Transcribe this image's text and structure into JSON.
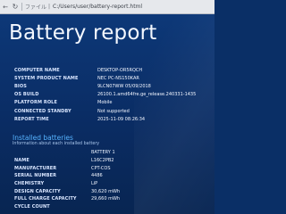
{
  "browser": {
    "url": "C:/Users/user/battery-report.html",
    "lock_label": "ファイル"
  },
  "page": {
    "title": "Battery report"
  },
  "system_info": [
    {
      "label": "COMPUTER NAME",
      "value": "DESKTOP-OR5RQCH"
    },
    {
      "label": "SYSTEM PRODUCT NAME",
      "value": "NEC PC-NS150KAR"
    },
    {
      "label": "BIOS",
      "value": "9LCN07WW 05/09/2018"
    },
    {
      "label": "OS BUILD",
      "value": "26100.1.amd64fre.ge_release.240331-1435"
    },
    {
      "label": "PLATFORM ROLE",
      "value": "Mobile"
    },
    {
      "label": "CONNECTED STANDBY",
      "value": "Not supported"
    },
    {
      "label": "REPORT TIME",
      "value": "2025-11-09   08:26:34"
    }
  ],
  "installed_batteries": {
    "title": "Installed batteries",
    "subtitle": "Information about each installed battery",
    "column_header": "BATTERY 1",
    "rows": [
      {
        "label": "NAME",
        "value": "L16C2PB2"
      },
      {
        "label": "MANUFACTURER",
        "value": "CPT-COS"
      },
      {
        "label": "SERIAL NUMBER",
        "value": "4486"
      },
      {
        "label": "CHEMISTRY",
        "value": "LiP"
      },
      {
        "label": "DESIGN CAPACITY",
        "value": "30,620 mWh"
      },
      {
        "label": "FULL CHARGE CAPACITY",
        "value": "29,660 mWh"
      },
      {
        "label": "CYCLE COUNT",
        "value": ""
      }
    ]
  }
}
